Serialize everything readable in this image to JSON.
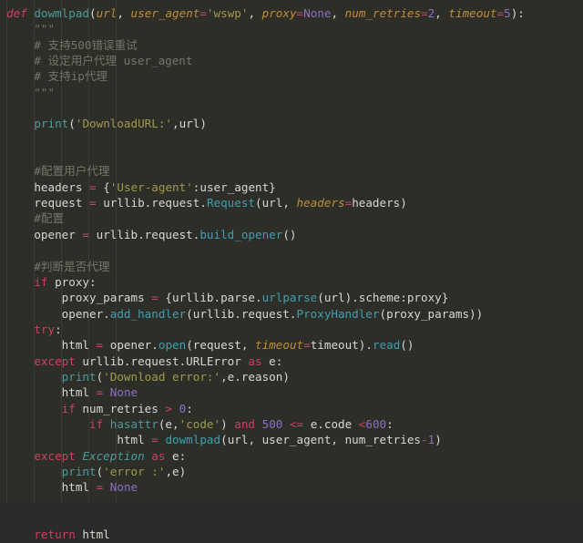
{
  "editor": {
    "language": "python",
    "theme": "dark-monokai-like",
    "background_color": "#2e2e29",
    "default_text_color": "#d8d8d2",
    "colors": {
      "keyword": "#cc3f61",
      "function": "#4b9b9b",
      "call": "#3f9fb0",
      "parameter": "#c08c3a",
      "string": "#9e9a4e",
      "number": "#8b6fc4",
      "operator": "#b0506b",
      "comment": "#73756a",
      "docstring": "#6e7064"
    }
  },
  "code": {
    "lines": [
      {
        "id": 1,
        "indent": 0,
        "tokens": [
          {
            "t": "def",
            "c": "kw-i"
          },
          {
            "t": " ",
            "c": "pln"
          },
          {
            "t": "dowmlpad",
            "c": "fn"
          },
          {
            "t": "(",
            "c": "pln"
          },
          {
            "t": "url",
            "c": "param"
          },
          {
            "t": ", ",
            "c": "pln"
          },
          {
            "t": "user_agent",
            "c": "param"
          },
          {
            "t": "=",
            "c": "op"
          },
          {
            "t": "'wswp'",
            "c": "str"
          },
          {
            "t": ", ",
            "c": "pln"
          },
          {
            "t": "proxy",
            "c": "param"
          },
          {
            "t": "=",
            "c": "op"
          },
          {
            "t": "None",
            "c": "num"
          },
          {
            "t": ", ",
            "c": "pln"
          },
          {
            "t": "num_retries",
            "c": "param"
          },
          {
            "t": "=",
            "c": "op"
          },
          {
            "t": "2",
            "c": "num"
          },
          {
            "t": ", ",
            "c": "pln"
          },
          {
            "t": "timeout",
            "c": "param"
          },
          {
            "t": "=",
            "c": "op"
          },
          {
            "t": "5",
            "c": "num"
          },
          {
            "t": "):",
            "c": "pln"
          }
        ]
      },
      {
        "id": 2,
        "indent": 1,
        "tokens": [
          {
            "t": "\"\"\"",
            "c": "doc"
          }
        ]
      },
      {
        "id": 3,
        "indent": 1,
        "tokens": [
          {
            "t": "# 支持500错误重试",
            "c": "cmt"
          }
        ]
      },
      {
        "id": 4,
        "indent": 1,
        "tokens": [
          {
            "t": "# 设定用户代理 user_agent",
            "c": "cmt"
          }
        ]
      },
      {
        "id": 5,
        "indent": 1,
        "tokens": [
          {
            "t": "# 支持ip代理",
            "c": "cmt"
          }
        ]
      },
      {
        "id": 6,
        "indent": 1,
        "tokens": [
          {
            "t": "\"\"\"",
            "c": "doc"
          }
        ]
      },
      {
        "id": 7,
        "indent": 0,
        "tokens": []
      },
      {
        "id": 8,
        "indent": 1,
        "tokens": [
          {
            "t": "print",
            "c": "fn"
          },
          {
            "t": "(",
            "c": "pln"
          },
          {
            "t": "'DownloadURL:'",
            "c": "str"
          },
          {
            "t": ",url)",
            "c": "pln"
          }
        ]
      },
      {
        "id": 9,
        "indent": 0,
        "tokens": []
      },
      {
        "id": 10,
        "indent": 0,
        "tokens": []
      },
      {
        "id": 11,
        "indent": 1,
        "tokens": [
          {
            "t": "#配置用户代理",
            "c": "cmt"
          }
        ]
      },
      {
        "id": 12,
        "indent": 1,
        "tokens": [
          {
            "t": "headers ",
            "c": "pln"
          },
          {
            "t": "=",
            "c": "op"
          },
          {
            "t": " {",
            "c": "pln"
          },
          {
            "t": "'User-agent'",
            "c": "str"
          },
          {
            "t": ":user_agent}",
            "c": "pln"
          }
        ]
      },
      {
        "id": 13,
        "indent": 1,
        "tokens": [
          {
            "t": "request ",
            "c": "pln"
          },
          {
            "t": "=",
            "c": "op"
          },
          {
            "t": " urllib.request.",
            "c": "pln"
          },
          {
            "t": "Request",
            "c": "call"
          },
          {
            "t": "(url, ",
            "c": "pln"
          },
          {
            "t": "headers",
            "c": "param"
          },
          {
            "t": "=",
            "c": "op"
          },
          {
            "t": "headers)",
            "c": "pln"
          }
        ]
      },
      {
        "id": 14,
        "indent": 1,
        "tokens": [
          {
            "t": "#配置",
            "c": "cmt"
          }
        ]
      },
      {
        "id": 15,
        "indent": 1,
        "tokens": [
          {
            "t": "opener ",
            "c": "pln"
          },
          {
            "t": "=",
            "c": "op"
          },
          {
            "t": " urllib.request.",
            "c": "pln"
          },
          {
            "t": "build_opener",
            "c": "call"
          },
          {
            "t": "()",
            "c": "pln"
          }
        ]
      },
      {
        "id": 16,
        "indent": 0,
        "tokens": []
      },
      {
        "id": 17,
        "indent": 1,
        "tokens": [
          {
            "t": "#判断是否代理",
            "c": "cmt"
          }
        ]
      },
      {
        "id": 18,
        "indent": 1,
        "tokens": [
          {
            "t": "if",
            "c": "kw"
          },
          {
            "t": " proxy:",
            "c": "pln"
          }
        ]
      },
      {
        "id": 19,
        "indent": 2,
        "tokens": [
          {
            "t": "proxy_params ",
            "c": "pln"
          },
          {
            "t": "=",
            "c": "op"
          },
          {
            "t": " {urllib.parse.",
            "c": "pln"
          },
          {
            "t": "urlparse",
            "c": "call"
          },
          {
            "t": "(url).scheme:proxy}",
            "c": "pln"
          }
        ]
      },
      {
        "id": 20,
        "indent": 2,
        "tokens": [
          {
            "t": "opener.",
            "c": "pln"
          },
          {
            "t": "add_handler",
            "c": "call"
          },
          {
            "t": "(urllib.request.",
            "c": "pln"
          },
          {
            "t": "ProxyHandler",
            "c": "call"
          },
          {
            "t": "(proxy_params))",
            "c": "pln"
          }
        ]
      },
      {
        "id": 21,
        "indent": 1,
        "tokens": [
          {
            "t": "try",
            "c": "kw"
          },
          {
            "t": ":",
            "c": "pln"
          }
        ]
      },
      {
        "id": 22,
        "indent": 2,
        "tokens": [
          {
            "t": "html ",
            "c": "pln"
          },
          {
            "t": "=",
            "c": "op"
          },
          {
            "t": " opener.",
            "c": "pln"
          },
          {
            "t": "open",
            "c": "call"
          },
          {
            "t": "(request, ",
            "c": "pln"
          },
          {
            "t": "timeout",
            "c": "param"
          },
          {
            "t": "=",
            "c": "op"
          },
          {
            "t": "timeout).",
            "c": "pln"
          },
          {
            "t": "read",
            "c": "call"
          },
          {
            "t": "()",
            "c": "pln"
          }
        ]
      },
      {
        "id": 23,
        "indent": 1,
        "tokens": [
          {
            "t": "except",
            "c": "kw"
          },
          {
            "t": " urllib.request.URLError ",
            "c": "pln"
          },
          {
            "t": "as",
            "c": "kw"
          },
          {
            "t": " e:",
            "c": "pln"
          }
        ]
      },
      {
        "id": 24,
        "indent": 2,
        "tokens": [
          {
            "t": "print",
            "c": "fn"
          },
          {
            "t": "(",
            "c": "pln"
          },
          {
            "t": "'Download error:'",
            "c": "str"
          },
          {
            "t": ",e.reason)",
            "c": "pln"
          }
        ]
      },
      {
        "id": 25,
        "indent": 2,
        "tokens": [
          {
            "t": "html ",
            "c": "pln"
          },
          {
            "t": "=",
            "c": "op"
          },
          {
            "t": " ",
            "c": "pln"
          },
          {
            "t": "None",
            "c": "num"
          }
        ]
      },
      {
        "id": 26,
        "indent": 2,
        "tokens": [
          {
            "t": "if",
            "c": "kw"
          },
          {
            "t": " num_retries ",
            "c": "pln"
          },
          {
            "t": ">",
            "c": "cmp"
          },
          {
            "t": " ",
            "c": "pln"
          },
          {
            "t": "0",
            "c": "num"
          },
          {
            "t": ":",
            "c": "pln"
          }
        ]
      },
      {
        "id": 27,
        "indent": 3,
        "tokens": [
          {
            "t": "if",
            "c": "kw"
          },
          {
            "t": " ",
            "c": "pln"
          },
          {
            "t": "hasattr",
            "c": "fn"
          },
          {
            "t": "(e,",
            "c": "pln"
          },
          {
            "t": "'code'",
            "c": "str"
          },
          {
            "t": ") ",
            "c": "pln"
          },
          {
            "t": "and",
            "c": "kw"
          },
          {
            "t": " ",
            "c": "pln"
          },
          {
            "t": "500",
            "c": "num"
          },
          {
            "t": " ",
            "c": "pln"
          },
          {
            "t": "<=",
            "c": "cmp"
          },
          {
            "t": " e.code ",
            "c": "pln"
          },
          {
            "t": "<",
            "c": "cmp"
          },
          {
            "t": "600",
            "c": "num"
          },
          {
            "t": ":",
            "c": "pln"
          }
        ]
      },
      {
        "id": 28,
        "indent": 4,
        "tokens": [
          {
            "t": "html ",
            "c": "pln"
          },
          {
            "t": "=",
            "c": "op"
          },
          {
            "t": " ",
            "c": "pln"
          },
          {
            "t": "dowmlpad",
            "c": "call"
          },
          {
            "t": "(url, user_agent, num_retries",
            "c": "pln"
          },
          {
            "t": "-",
            "c": "op"
          },
          {
            "t": "1",
            "c": "num"
          },
          {
            "t": ")",
            "c": "pln"
          }
        ]
      },
      {
        "id": 29,
        "indent": 1,
        "tokens": [
          {
            "t": "except",
            "c": "kw"
          },
          {
            "t": " ",
            "c": "pln"
          },
          {
            "t": "Exception",
            "c": "fn-i"
          },
          {
            "t": " ",
            "c": "pln"
          },
          {
            "t": "as",
            "c": "kw"
          },
          {
            "t": " e:",
            "c": "pln"
          }
        ]
      },
      {
        "id": 30,
        "indent": 2,
        "tokens": [
          {
            "t": "print",
            "c": "fn"
          },
          {
            "t": "(",
            "c": "pln"
          },
          {
            "t": "'error :'",
            "c": "str"
          },
          {
            "t": ",e)",
            "c": "pln"
          }
        ]
      },
      {
        "id": 31,
        "indent": 2,
        "tokens": [
          {
            "t": "html ",
            "c": "pln"
          },
          {
            "t": "=",
            "c": "op"
          },
          {
            "t": " ",
            "c": "pln"
          },
          {
            "t": "None",
            "c": "num"
          }
        ]
      },
      {
        "id": 32,
        "indent": 0,
        "tokens": []
      },
      {
        "id": 33,
        "indent": 0,
        "tokens": []
      },
      {
        "id": 34,
        "indent": 1,
        "tokens": [
          {
            "t": "return",
            "c": "kw"
          },
          {
            "t": " html",
            "c": "pln"
          }
        ]
      }
    ]
  },
  "indent_guides": {
    "x_positions": [
      7,
      37,
      67,
      97,
      127
    ],
    "color": "#3a3a34"
  }
}
